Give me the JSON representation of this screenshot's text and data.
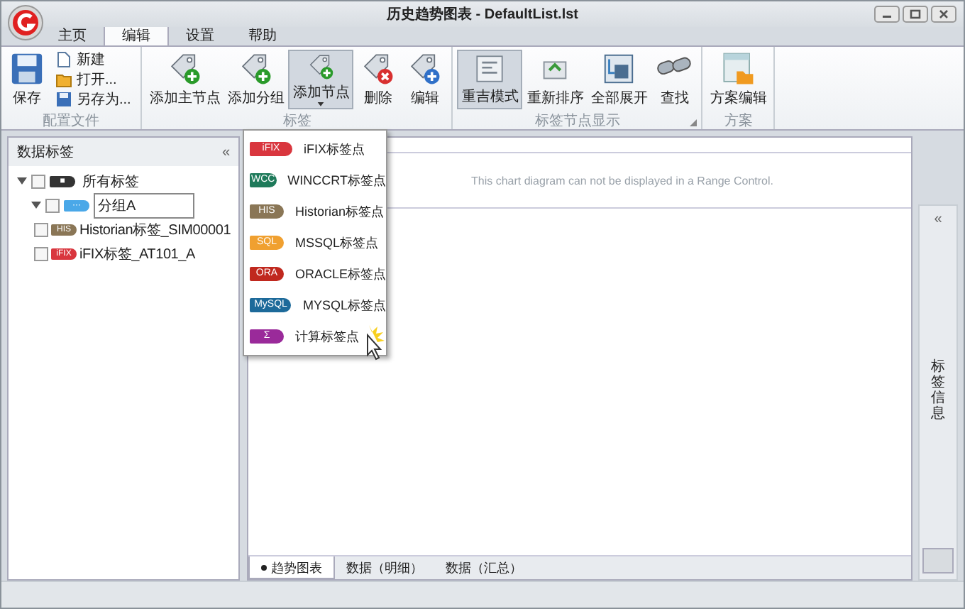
{
  "window": {
    "title": "历史趋势图表 - DefaultList.lst"
  },
  "tabs": [
    {
      "label": "主页",
      "selected": false
    },
    {
      "label": "编辑",
      "selected": true
    },
    {
      "label": "设置",
      "selected": false
    },
    {
      "label": "帮助",
      "selected": false
    }
  ],
  "ribbon": [
    {
      "label": "配置文件",
      "items": [
        {
          "kind": "large",
          "label": "保存",
          "pressed": false
        },
        {
          "kind": "small",
          "label": "新建"
        },
        {
          "kind": "small",
          "label": "打开..."
        },
        {
          "kind": "small",
          "label": "另存为..."
        }
      ]
    },
    {
      "label": "标签",
      "items": [
        {
          "kind": "large",
          "label": "添加主节点",
          "pressed": false
        },
        {
          "kind": "large",
          "label": "添加分组",
          "pressed": false
        },
        {
          "kind": "large",
          "label": "添加节点",
          "pressed": true,
          "dropdown": true
        },
        {
          "kind": "large",
          "label": "删除",
          "pressed": false
        },
        {
          "kind": "large",
          "label": "编辑",
          "pressed": false
        }
      ]
    },
    {
      "label": "标签节点显示",
      "launcher": true,
      "items": [
        {
          "kind": "large",
          "label": "重吉模式",
          "pressed": true
        },
        {
          "kind": "large",
          "label": "重新排序",
          "pressed": false
        },
        {
          "kind": "large",
          "label": "全部展开",
          "pressed": false
        },
        {
          "kind": "large",
          "label": "查找",
          "pressed": false
        }
      ]
    },
    {
      "label": "方案",
      "items": [
        {
          "kind": "large",
          "label": "方案编辑",
          "pressed": false
        }
      ]
    }
  ],
  "menu": [
    {
      "badge": "iFIX",
      "color": "#d9363e",
      "label": "iFIX标签点"
    },
    {
      "badge": "WCC",
      "color": "#1e7a5a",
      "label": "WINCCRT标签点"
    },
    {
      "badge": "HIS",
      "color": "#8a7656",
      "label": "Historian标签点"
    },
    {
      "badge": "SQL",
      "color": "#f0a030",
      "label": "MSSQL标签点"
    },
    {
      "badge": "ORA",
      "color": "#c0281e",
      "label": "ORACLE标签点"
    },
    {
      "badge": "MySQL",
      "color": "#1d6a9a",
      "label": "MYSQL标签点"
    },
    {
      "badge": "Σ",
      "color": "#9a2a9a",
      "label": "计算标签点"
    }
  ],
  "sidebar": {
    "title": "数据标签",
    "collapse": "«",
    "tree": [
      {
        "label": "所有标签",
        "badge": "■",
        "color": "#333333",
        "checked": false,
        "expanded": true,
        "children": [
          {
            "label": "分组A",
            "badge": "···",
            "color": "#4aa8e8",
            "checked": false,
            "expanded": true,
            "selected": true,
            "children": [
              {
                "label": "Historian标签_SIM00001",
                "badge": "HIS",
                "color": "#8a7656",
                "checked": false,
                "selected": false
              },
              {
                "label": "iFIX标签_AT101_A",
                "badge": "iFIX",
                "color": "#d9363e",
                "checked": false,
                "selected": false
              }
            ]
          }
        ],
        "selected": false
      }
    ]
  },
  "range_control": {
    "message": "This chart diagram can not be displayed in a Range Control."
  },
  "bottom_tabs": [
    {
      "label": "趋势图表",
      "selected": true
    },
    {
      "label": "数据（明细）",
      "selected": false
    },
    {
      "label": "数据（汇总）",
      "selected": false
    }
  ],
  "right_panel": {
    "collapse": "«",
    "title": "标签信息"
  }
}
